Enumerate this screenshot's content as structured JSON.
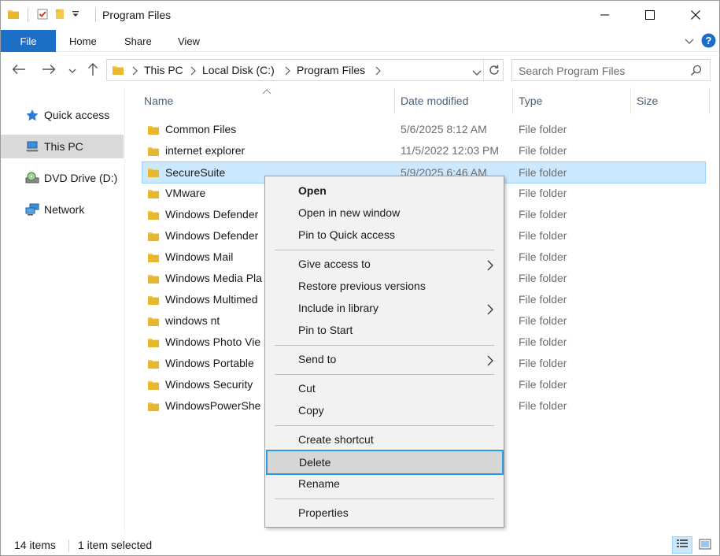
{
  "window": {
    "title": "Program Files",
    "controls": {
      "minimize": "minimize-icon",
      "maximize": "maximize-icon",
      "close": "close-icon"
    }
  },
  "ribbon": {
    "tabs": [
      {
        "label": "File"
      },
      {
        "label": "Home"
      },
      {
        "label": "Share"
      },
      {
        "label": "View"
      }
    ]
  },
  "address": {
    "crumbs": [
      "This PC",
      "Local Disk (C:)",
      "Program Files"
    ]
  },
  "search": {
    "placeholder": "Search Program Files"
  },
  "navpane": {
    "items": [
      {
        "label": "Quick access",
        "icon": "star-icon"
      },
      {
        "label": "This PC",
        "icon": "computer-icon",
        "selected": true
      },
      {
        "label": "DVD Drive (D:)",
        "icon": "dvd-drive-icon"
      },
      {
        "label": "Network",
        "icon": "network-icon"
      }
    ]
  },
  "columns": {
    "name": "Name",
    "date": "Date modified",
    "type": "Type",
    "size": "Size"
  },
  "files": [
    {
      "name": "Common Files",
      "date": "5/6/2025 8:12 AM",
      "type": "File folder"
    },
    {
      "name": "internet explorer",
      "date": "11/5/2022 12:03 PM",
      "type": "File folder"
    },
    {
      "name": "SecureSuite",
      "date": "5/9/2025 6:46 AM",
      "type": "File folder",
      "selected": true
    },
    {
      "name": "VMware",
      "date": "",
      "type": "File folder"
    },
    {
      "name": "Windows Defender",
      "date": "",
      "type": "File folder"
    },
    {
      "name": "Windows Defender",
      "date": "",
      "type": "File folder"
    },
    {
      "name": "Windows Mail",
      "date": "",
      "type": "File folder"
    },
    {
      "name": "Windows Media Pla",
      "date": "",
      "type": "File folder"
    },
    {
      "name": "Windows Multimed",
      "date": "",
      "type": "File folder"
    },
    {
      "name": "windows nt",
      "date": "",
      "type": "File folder"
    },
    {
      "name": "Windows Photo Vie",
      "date": "",
      "type": "File folder"
    },
    {
      "name": "Windows Portable",
      "date": "",
      "type": "File folder"
    },
    {
      "name": "Windows Security",
      "date": "",
      "type": "File folder"
    },
    {
      "name": "WindowsPowerShe",
      "date": "",
      "type": "File folder"
    }
  ],
  "context_menu": {
    "open": "Open",
    "open_new_window": "Open in new window",
    "pin_quick_access": "Pin to Quick access",
    "give_access": "Give access to",
    "restore_versions": "Restore previous versions",
    "include_library": "Include in library",
    "pin_start": "Pin to Start",
    "send_to": "Send to",
    "cut": "Cut",
    "copy": "Copy",
    "create_shortcut": "Create shortcut",
    "delete": "Delete",
    "rename": "Rename",
    "properties": "Properties",
    "highlighted": "Delete"
  },
  "status": {
    "item_count": "14 items",
    "selection": "1 item selected"
  },
  "colors": {
    "accent": "#1c6fc6",
    "selection_bg": "#cce8ff",
    "selection_border": "#99d1ff",
    "menu_focus_border": "#2d9be3",
    "folder_yellow": "#f4c84a"
  }
}
